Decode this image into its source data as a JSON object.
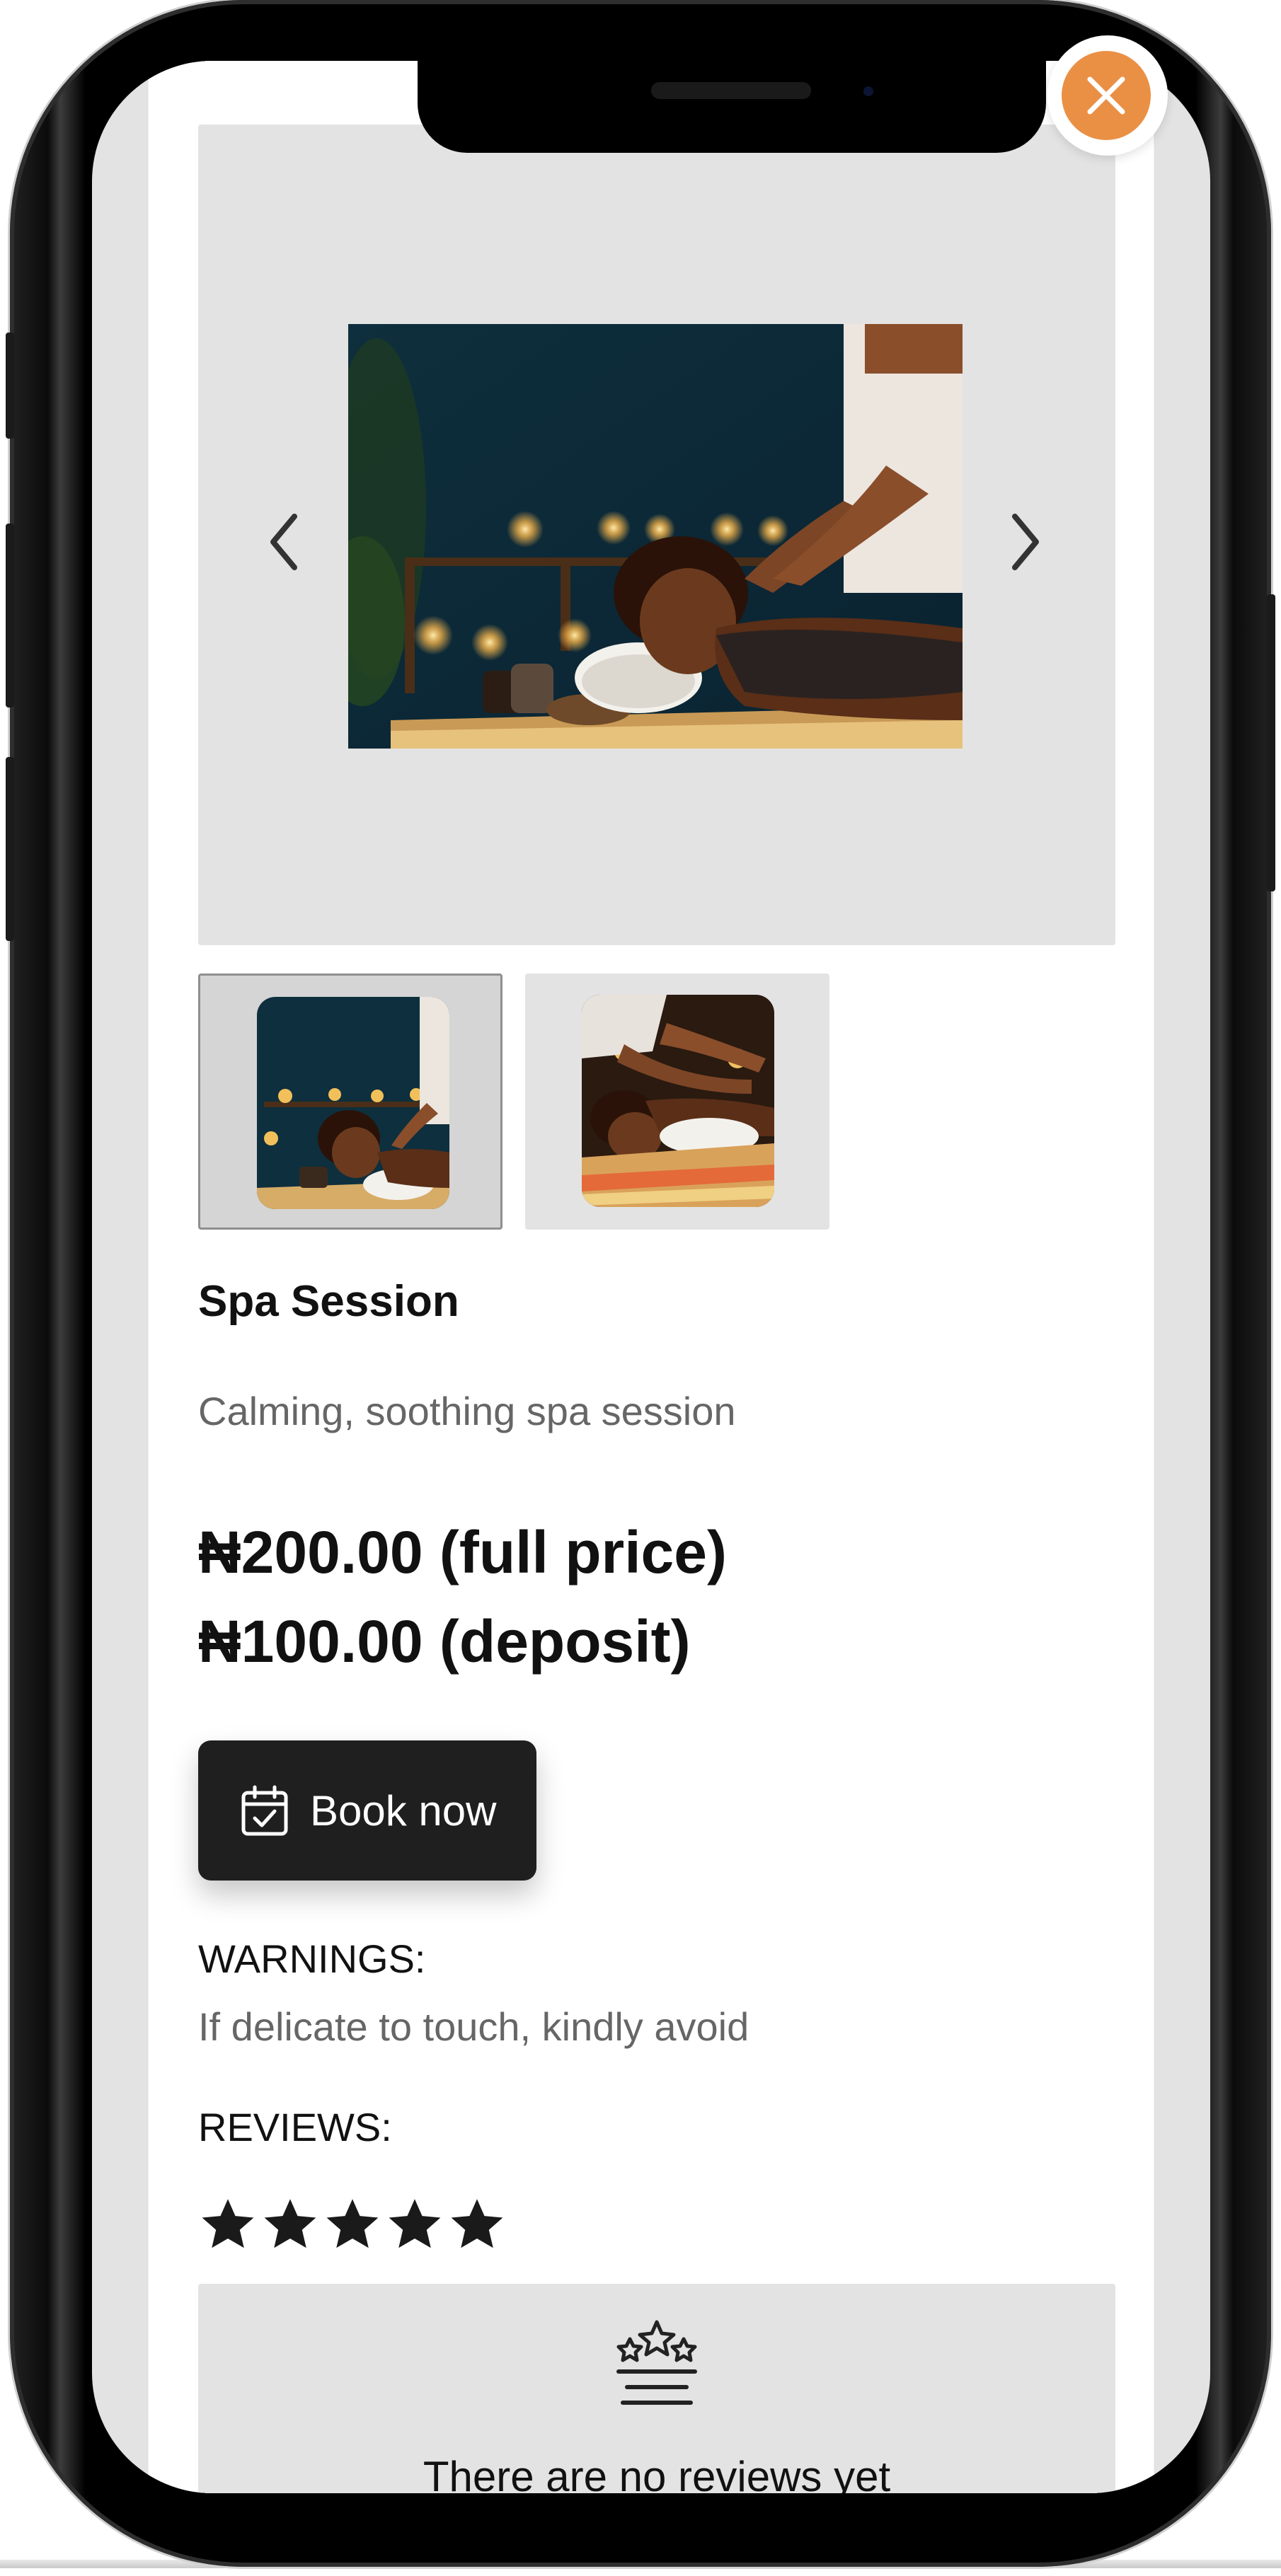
{
  "product": {
    "title": "Spa Session",
    "description": "Calming, soothing spa session",
    "price_full": "₦200.00 (full price)",
    "price_deposit": "₦100.00 (deposit)"
  },
  "gallery": {
    "prev_icon": "chevron-left-icon",
    "next_icon": "chevron-right-icon",
    "thumbnails": [
      "spa-photo-1",
      "spa-photo-2"
    ],
    "active_thumbnail": 0
  },
  "actions": {
    "book_label": "Book now",
    "book_icon": "calendar-check-icon",
    "close_icon": "close-icon"
  },
  "warnings": {
    "heading": "WARNINGS:",
    "text": "If delicate to touch, kindly avoid"
  },
  "reviews": {
    "heading": "REVIEWS:",
    "rating": 5,
    "max_rating": 5,
    "empty_icon": "rating-stars-icon",
    "empty_text": "There are no reviews yet"
  },
  "colors": {
    "accent": "#ea9045",
    "button_bg": "#1f1f1f",
    "panel_bg": "#e3e3e3",
    "text_muted": "#666666"
  }
}
